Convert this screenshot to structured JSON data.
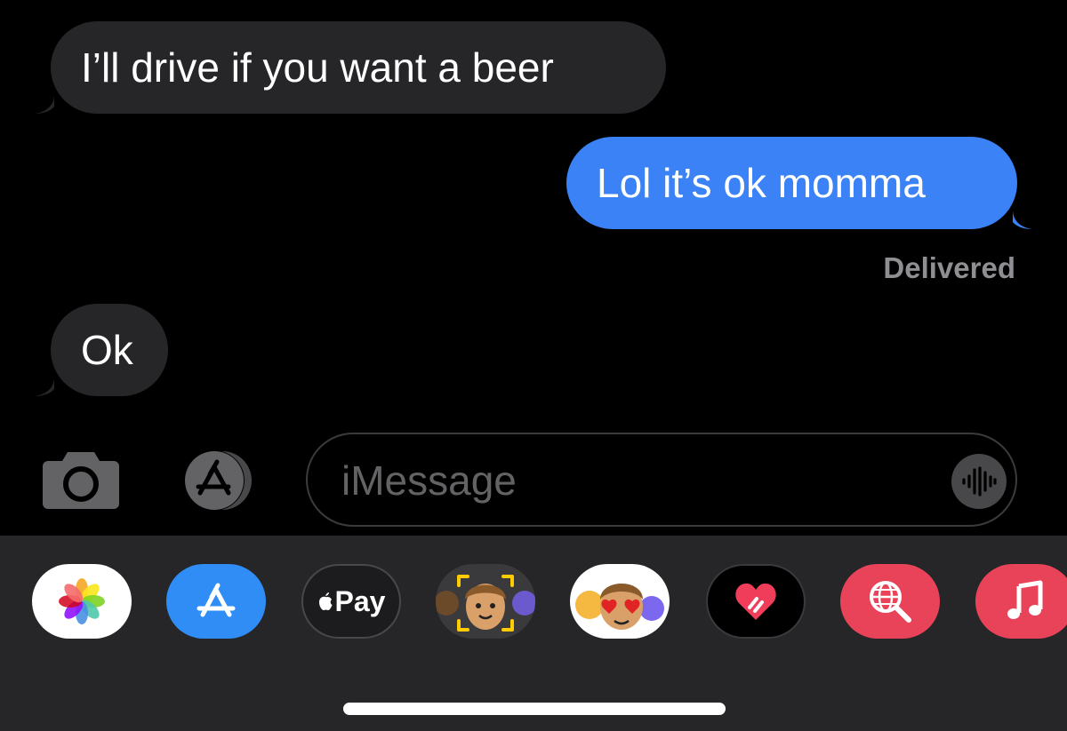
{
  "thread": {
    "messages": [
      {
        "direction": "incoming",
        "text": "I’ll drive if you want a beer"
      },
      {
        "direction": "outgoing",
        "text": "Lol it’s ok momma"
      },
      {
        "direction": "incoming",
        "text": "Ok"
      }
    ],
    "status": "Delivered"
  },
  "compose": {
    "placeholder": "iMessage",
    "camera_icon": "camera-icon",
    "apps_icon": "app-store-icon",
    "audio_icon": "audio-waveform-icon"
  },
  "app_drawer": {
    "apps": [
      {
        "name": "photos",
        "icon": "photos-icon"
      },
      {
        "name": "app-store",
        "icon": "app-store-icon"
      },
      {
        "name": "apple-pay",
        "icon": "apple-pay-icon",
        "label": "Pay"
      },
      {
        "name": "memoji",
        "icon": "memoji-icon"
      },
      {
        "name": "memoji-stickers",
        "icon": "memoji-stickers-icon"
      },
      {
        "name": "digital-touch",
        "icon": "digital-touch-heart-icon"
      },
      {
        "name": "images-search",
        "icon": "globe-search-icon"
      },
      {
        "name": "music",
        "icon": "music-note-icon"
      }
    ]
  },
  "colors": {
    "background": "#000000",
    "incoming_bubble": "#262628",
    "outgoing_bubble": "#3a82f6",
    "status_text": "#8e8e93",
    "drawer": "#262628"
  }
}
